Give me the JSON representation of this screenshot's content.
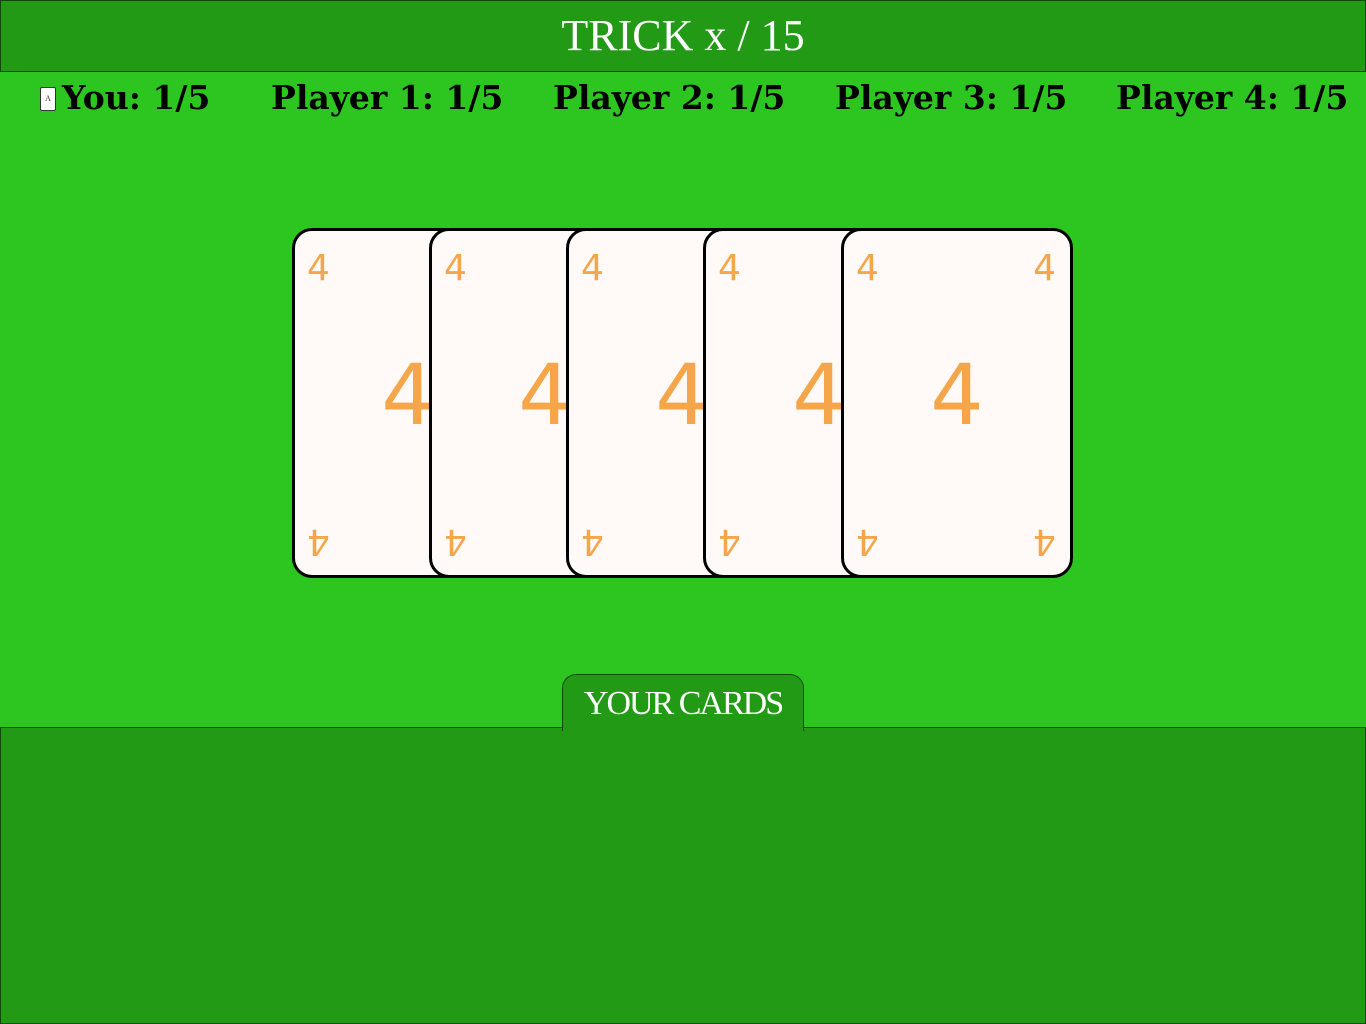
{
  "header": {
    "title": "TRICK x / 15"
  },
  "dealer_marker": "A",
  "scores": [
    {
      "label": "You: 1/5"
    },
    {
      "label": "Player 1: 1/5"
    },
    {
      "label": "Player 2: 1/5"
    },
    {
      "label": "Player 3: 1/5"
    },
    {
      "label": "Player 4: 1/5"
    }
  ],
  "trick_cards": [
    {
      "rank": "4",
      "color": "#f5a64a"
    },
    {
      "rank": "4",
      "color": "#f5a64a"
    },
    {
      "rank": "4",
      "color": "#f5a64a"
    },
    {
      "rank": "4",
      "color": "#f5a64a"
    },
    {
      "rank": "4",
      "color": "#f5a64a"
    }
  ],
  "hand": {
    "tab_label": "YOUR CARDS",
    "cards": []
  },
  "colors": {
    "table": "#2dc51f",
    "panel": "#239a16",
    "card_face": "#fffaf8",
    "card_ink": "#f5a64a"
  }
}
